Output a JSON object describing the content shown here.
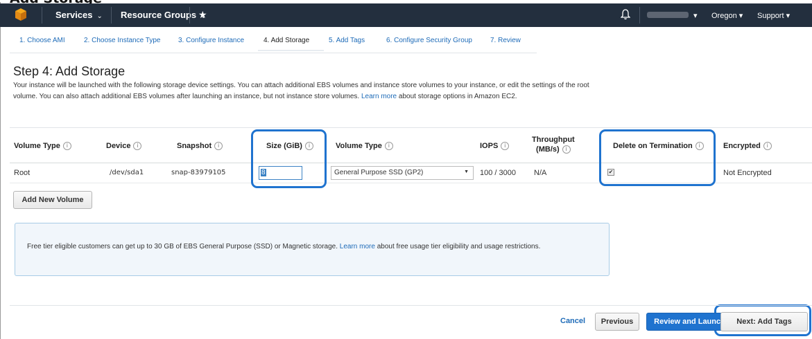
{
  "caption_text": "Add Storage",
  "navbar": {
    "services_label": "Services",
    "resource_groups_label": "Resource Groups",
    "region_label": "Oregon",
    "support_label": "Support"
  },
  "wizard": {
    "steps": [
      {
        "label": "1. Choose AMI"
      },
      {
        "label": "2. Choose Instance Type"
      },
      {
        "label": "3. Configure Instance"
      },
      {
        "label": "4. Add Storage"
      },
      {
        "label": "5. Add Tags"
      },
      {
        "label": "6. Configure Security Group"
      },
      {
        "label": "7. Review"
      }
    ],
    "active_step": 4
  },
  "page": {
    "title": "Step 4: Add Storage",
    "description_1": "Your instance will be launched with the following storage device settings. You can attach additional EBS volumes and instance store volumes to your instance, or edit the settings of the root volume. You can also attach additional EBS volumes after launching an instance, but not instance store volumes. ",
    "description_link": "Learn more",
    "description_2": " about storage options in Amazon EC2."
  },
  "table": {
    "headers": {
      "volume_type": "Volume Type",
      "device": "Device",
      "snapshot": "Snapshot",
      "size": "Size (GiB)",
      "volume_type2": "Volume Type",
      "iops": "IOPS",
      "throughput_1": "Throughput",
      "throughput_2": "(MB/s)",
      "delete_on_termination": "Delete on Termination",
      "encrypted": "Encrypted"
    },
    "info_glyph": "i",
    "row": {
      "volume_type": "Root",
      "device": "/dev/sda1",
      "snapshot": "snap-83979105",
      "size": "8",
      "volume_type_select": "General Purpose SSD (GP2)",
      "iops": "100 / 3000",
      "throughput": "N/A",
      "delete_on_termination": true,
      "encrypted": "Not Encrypted"
    }
  },
  "buttons": {
    "add_volume": "Add New Volume",
    "cancel": "Cancel",
    "previous": "Previous",
    "review_launch": "Review and Launch",
    "next": "Next: Add Tags"
  },
  "info_panel": {
    "text_1": "Free tier eligible customers can get up to 30 GB of EBS General Purpose (SSD) or Magnetic storage. ",
    "link": "Learn more",
    "text_2": " about free usage tier eligibility and usage restrictions."
  },
  "colors": {
    "navbar": "#232f3e",
    "accent": "#1f73cf",
    "link": "#1e6bb8"
  }
}
